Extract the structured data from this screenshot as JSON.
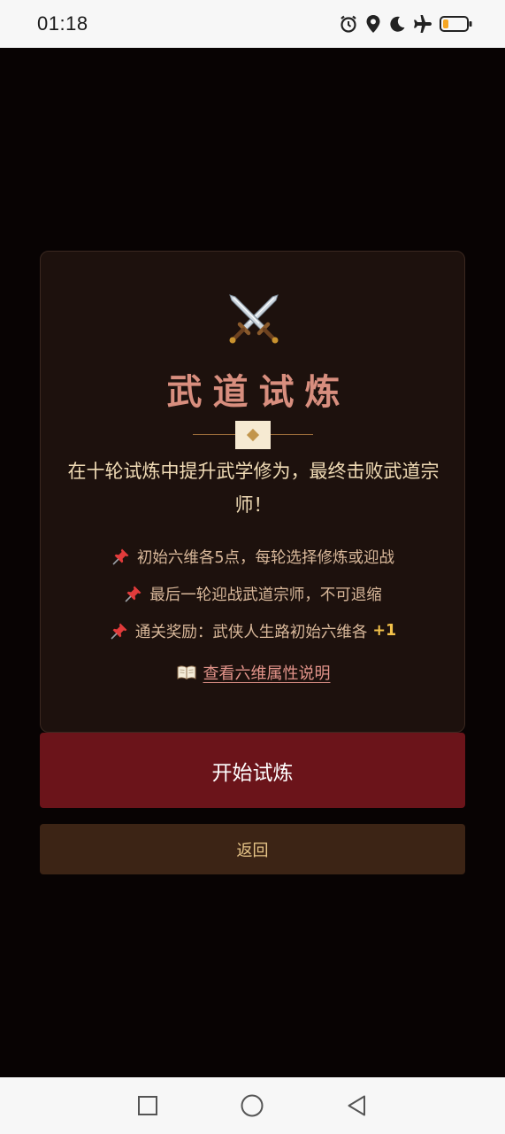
{
  "status_bar": {
    "time": "01:18",
    "icons": [
      "alarm-icon",
      "location-icon",
      "moon-icon",
      "airplane-icon",
      "battery-icon"
    ],
    "battery_color": "#f5a623"
  },
  "card": {
    "icon": "crossed-swords-icon",
    "title": "武道试炼",
    "description": "在十轮试炼中提升武学修为，最终击败武道宗师！",
    "rules": [
      {
        "icon": "pin-icon",
        "text": "初始六维各5点，每轮选择修炼或迎战",
        "highlight": ""
      },
      {
        "icon": "pin-icon",
        "text": "最后一轮迎战武道宗师，不可退缩",
        "highlight": ""
      },
      {
        "icon": "pin-icon",
        "text": "通关奖励：武侠人生路初始六维各",
        "highlight": "+1"
      }
    ],
    "attr_link": {
      "icon": "book-icon",
      "label": "查看六维属性说明"
    }
  },
  "buttons": {
    "start_label": "开始试炼",
    "back_label": "返回"
  },
  "nav_bar": {
    "icons": [
      "recent-apps-icon",
      "home-icon",
      "back-icon"
    ]
  },
  "colors": {
    "background": "#080303",
    "card_bg": "#1d110d",
    "title": "#d88e7e",
    "start_button": "#6b141a",
    "back_button": "#3c2415",
    "highlight": "#f2c14a",
    "link": "#e3948a"
  }
}
